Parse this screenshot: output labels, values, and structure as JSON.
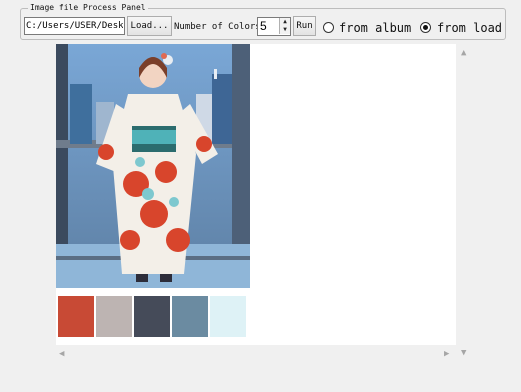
{
  "panel": {
    "title": "Image file Process Panel",
    "path_value": "C:/Users/USER/Desktop",
    "load_label": "Load...",
    "colors_label": "Number of Colors",
    "num_colors": "5",
    "run_label": "Run",
    "radio_album_label": "from album",
    "radio_load_label": "from load",
    "selected_source": "from load"
  },
  "palette": {
    "colors": [
      "#c84a35",
      "#bdb4b2",
      "#454b59",
      "#6b8ba1",
      "#def2f6"
    ]
  },
  "icons": {
    "spin_up": "▲",
    "spin_down": "▼",
    "scroll_up": "▲",
    "scroll_down": "▼",
    "scroll_left": "◀",
    "scroll_right": "▶"
  }
}
